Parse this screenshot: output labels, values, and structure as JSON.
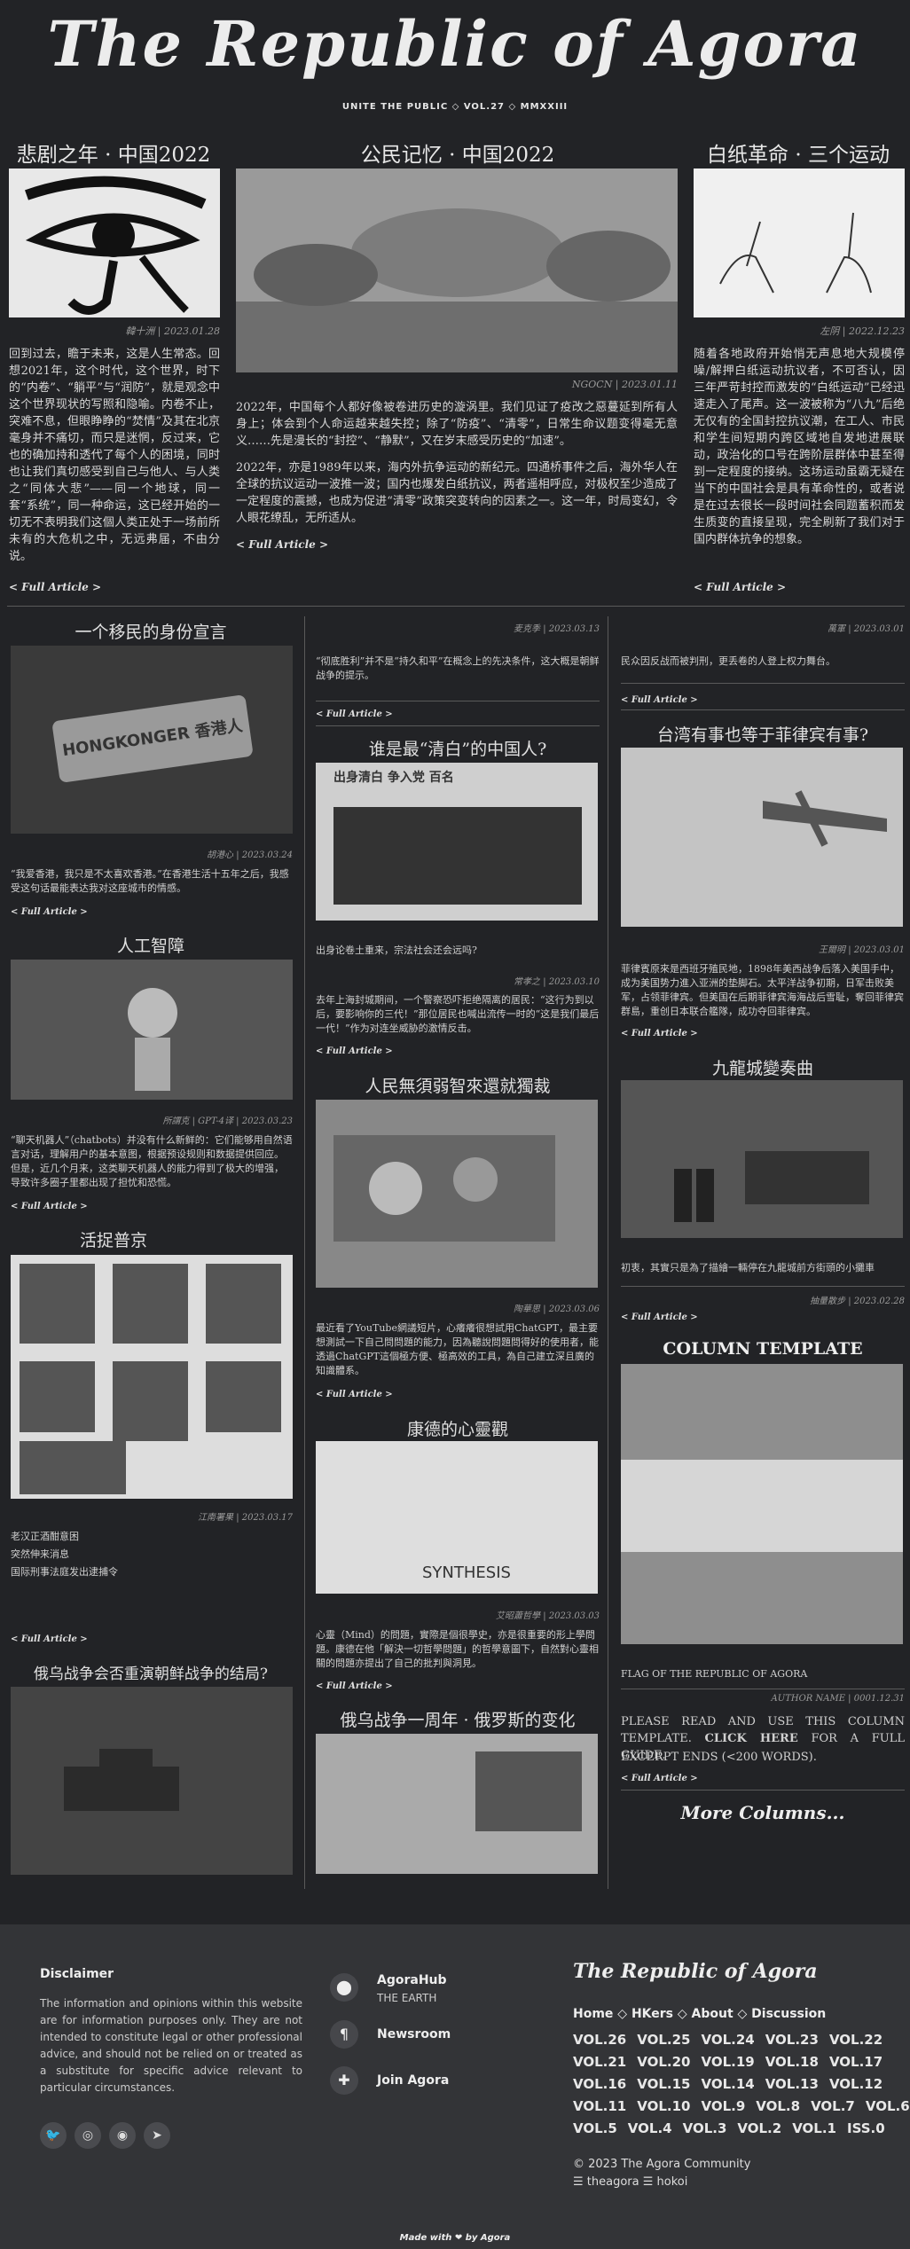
{
  "masthead": {
    "title": "The Republic of Agora",
    "subtitle": "UNITE THE PUBLIC ◇ VOL.27 ◇ MMXXIII"
  },
  "col1": {
    "title": "悲剧之年 · 中国2022",
    "credit": "韓十洲 | 2023.01.28",
    "text": "回到过去，瞻于未来，这是人生常态。回想2021年，这个时代，这个世界，时下的“内卷”、“躺平”与“润防”，就是观念中这个世界现状的写照和隐喻。内卷不止，突难不息，但眼睁睁的“焚情”及其在北京毫身并不痛切，而只是迷惘，反过来，它也的确加持和透代了每个人的困境，同时也让我们真切感受到自己与他人、与人类之“同体大悲”——同一个地球，同一套“系统”，同一种命运，这已经开始的一切无不表明我们这個人类正处于一场前所未有的大危机之中，无远弗届，不由分说。",
    "more": "< Full Article >"
  },
  "col2": {
    "title": "公民记忆 · 中国2022",
    "credit": "NGOCN | 2023.01.11",
    "p1": "2022年，中国每个人都好像被卷进历史的漩涡里。我们见证了疫改之惡蔓延到所有人身上；体会到个人命运越来越失控；除了“防疫”、“清零”，日常生命议题变得毫无意义……先是漫长的“封控”、“静默”，又在岁末感受历史的“加速”。",
    "p2": "2022年，亦是1989年以来，海内外抗争运动的新纪元。四通桥事件之后，海外华人在全球的抗议运动一波推一波；国内也爆发白纸抗议，两者遥相呼应，对极权至少造成了一定程度的震撼，也成为促进“清零”政策突变转向的因素之一。这一年，时局变幻，令人眼花缭乱，无所适从。",
    "more": "< Full Article >"
  },
  "col3": {
    "title": "白纸革命 · 三个运动",
    "credit": "左阴 | 2022.12.23",
    "text": "随着各地政府开始悄无声息地大规模停噪/解押白纸运动抗议者，不可否认，因三年严苛封控而激发的“白纸运动”已经迅速走入了尾声。这一波被称为“八九”后绝无仅有的全国封控抗议潮，在工人、市民和学生间短期内跨区域地自发地进展联动，政治化的口号在跨阶层群体中甚至得到一定程度的接纳。这场运动虽霸无疑在当下的中国社会是具有革命性的，或者说是在过去很长一段时间社会同题蓄积而发生质变的直接呈现，完全刷新了我们对于国内群体抗争的想象。",
    "more": "< Full Article >"
  },
  "left": [
    {
      "title": "一个移民的身份宣言",
      "credit": "胡港心 | 2023.03.24",
      "text": "“我爱香港，我只是不太喜欢香港。”在香港生活十五年之后，我感受这句话最能表达我对这座城市的情感。",
      "more": "< Full Article >",
      "img_text": "HONGKONGER 香港人"
    },
    {
      "title": "人工智障",
      "credit": "所謂克 | GPT-4译 | 2023.03.23",
      "text": "“聊天机器人”（chatbots）并没有什么新鲜的：它们能够用自然语言对话，理解用户的基本意图，根据预设规则和数据提供回应。但是，近几个月来，这类聊天机器人的能力得到了极大的增强，导致许多圈子里都出现了担忧和恐慌。",
      "more": "< Full Article >"
    },
    {
      "title": "活捉普京",
      "credit": "江南署果 | 2023.03.17",
      "lines": [
        "老汉正酒酣意困",
        "突然伸来消息",
        "国际刑事法庭发出逮捕令"
      ],
      "more": "< Full Article >"
    },
    {
      "title": "俄乌战争会否重演朝鲜战争的结局?"
    }
  ],
  "middle": [
    {
      "credit": "麦克季 | 2023.03.13",
      "text": "“彻底胜利”并不是“持久和平”在概念上的先决条件，这大概是朝鲜战争的提示。",
      "more": "< Full Article >"
    },
    {
      "title": "谁是最“清白”的中国人?",
      "credit": "常孝之 | 2023.03.10",
      "text1": "出身论卷土重来，宗法社会还会远吗?",
      "text2": "去年上海封城期间，一个警察恐吓拒绝隔离的居民：“这行为到以后，要影响你的三代！”那位居民也喊出流传一时的“这是我们最后一代！”作为对连坐威胁的激情反击。",
      "more": "< Full Article >",
      "img_text": "出身清白 争入党 百名"
    },
    {
      "title": "人民無須弱智來還就獨裁",
      "credit": "陶華思 | 2023.03.06",
      "text": "最近看了YouTube網議短片，心癢癢很想試用ChatGPT，最主要想測試一下自己問問題的能力，因為聽說問題問得好的使用者，能透過ChatGPT這個極方便、極高效的工具，為自己建立深且廣的知識體系。",
      "more": "< Full Article >"
    },
    {
      "title": "康德的心靈觀",
      "credit": "艾昭蕭哲學 | 2023.03.03",
      "text": "心靈（Mind）的問題，實際是個很學史，亦是很重要的形上學問題。康德在他「解決一切哲學問題」的哲學意圖下，自然對心靈相關的問題亦提出了自己的批判與洞見。",
      "more": "< Full Article >",
      "img_text": "SYNTHESIS"
    },
    {
      "title": "俄乌战争一周年 · 俄罗斯的变化"
    }
  ],
  "right": [
    {
      "credit": "萬軍 | 2023.03.01",
      "text": "民众因反战而被判刑，更丢卷的人登上权力舞台。",
      "more": "< Full Article >"
    },
    {
      "title": "台湾有事也等于菲律宾有事?",
      "credit": "王爾明 | 2023.03.01",
      "text": "菲律賓原來是西班牙殖民地，1898年美西战争后落入美国手中，成为美国势力進入亚洲的垫脚石。太平洋战争初期，日军击败美军，占领菲律宾。但美国在后期菲律宾海海战后雪耻，奪回菲律宾群島，重创日本联合艦隊，成功夺回菲律宾。",
      "more": "< Full Article >"
    },
    {
      "title": "九龍城變奏曲",
      "credit": "抽量散步 | 2023.02.28",
      "text": "初衷，其實只是為了描繪一輛停在九龍城前方街頭的小攤車",
      "more": "< Full Article >"
    },
    {
      "title": "COLUMN TEMPLATE",
      "flag_caption": "FLAG OF THE REPUBLIC OF AGORA",
      "credit": "AUTHOR NAME | 0001.12.31",
      "text_a": "PLEASE READ AND USE THIS COLUMN TEMPLATE.",
      "click": "CLICK HERE",
      "text_b": "FOR A FULL GUIDE.",
      "excerpt": "EXCERPT ENDS (<200 WORDS).",
      "more": "< Full Article >",
      "colors": [
        "#8e8e8e",
        "#d6d6d6",
        "#8e8e8e"
      ]
    },
    {
      "more_columns": "More Columns..."
    }
  ],
  "footer": {
    "disclaimer_title": "Disclaimer",
    "disclaimer": "The information and opinions within this website are for information purposes only. They are not intended to constitute legal or other professional advice, and should not be relied on or treated as a substitute for specific advice relevant to particular circumstances.",
    "social": [
      {
        "icon": "twitter-icon",
        "glyph": "🐦"
      },
      {
        "icon": "github-icon",
        "glyph": "◎"
      },
      {
        "icon": "reddit-icon",
        "glyph": "◉"
      },
      {
        "icon": "telegram-icon",
        "glyph": "➤"
      }
    ],
    "links": [
      {
        "label": "AgoraHub",
        "sub": "THE EARTH",
        "icon": "location-icon",
        "glyph": "⬤"
      },
      {
        "label": "Newsroom",
        "sub": "",
        "icon": "paragraph-icon",
        "glyph": "¶"
      },
      {
        "label": "Join Agora",
        "sub": "",
        "icon": "puzzle-icon",
        "glyph": "✚"
      }
    ],
    "brand": "The Republic of Agora",
    "nav": [
      "Home",
      "HKers",
      "About",
      "Discussion"
    ],
    "vols": [
      [
        "VOL.26",
        "VOL.25",
        "VOL.24",
        "VOL.23",
        "VOL.22"
      ],
      [
        "VOL.21",
        "VOL.20",
        "VOL.19",
        "VOL.18",
        "VOL.17"
      ],
      [
        "VOL.16",
        "VOL.15",
        "VOL.14",
        "VOL.13",
        "VOL.12"
      ],
      [
        "VOL.11",
        "VOL.10",
        "VOL.9",
        "VOL.8",
        "VOL.7",
        "VOL.6"
      ],
      [
        "VOL.5",
        "VOL.4",
        "VOL.3",
        "VOL.2",
        "VOL.1",
        "ISS.0"
      ]
    ],
    "copyright": "© 2023 The Agora Community",
    "handles": "☰ theagora ☰ hokoi",
    "made": "Made with ❤ by Agora"
  }
}
